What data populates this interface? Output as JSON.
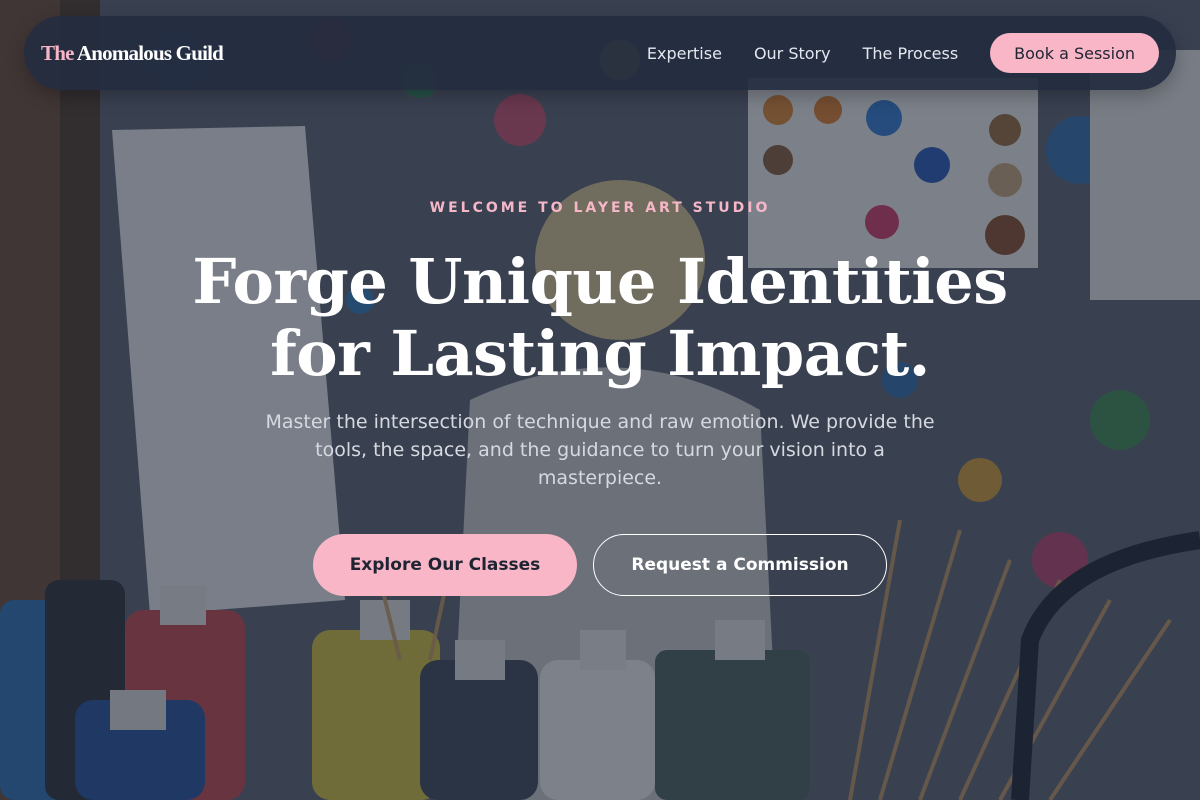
{
  "nav": {
    "brand_accent": "The",
    "brand_rest": " Anomalous Guild",
    "links": [
      {
        "label": "Expertise"
      },
      {
        "label": "Our Story"
      },
      {
        "label": "The Process"
      }
    ],
    "cta_label": "Book a Session"
  },
  "hero": {
    "eyebrow": "WELCOME TO LAYER ART STUDIO",
    "headline_line1": "Forge Unique Identities",
    "headline_line2": "for Lasting Impact.",
    "subtext": "Master the intersection of technique and raw emotion. We provide the tools, the space, and the guidance to turn your vision into a masterpiece.",
    "primary_cta": "Explore Our Classes",
    "secondary_cta": "Request a Commission"
  },
  "colors": {
    "accent_pink": "#f8b6c7",
    "nav_bg": "#242d40",
    "text_white": "#ffffff"
  }
}
